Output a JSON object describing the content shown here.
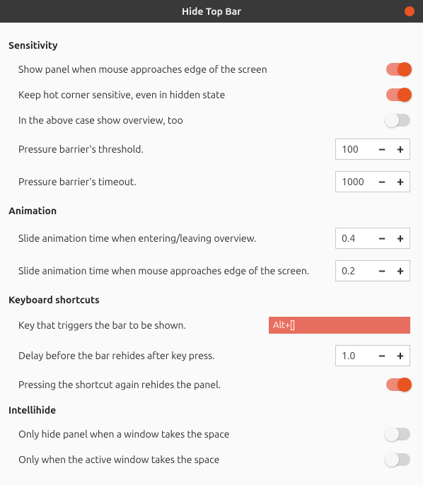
{
  "window": {
    "title": "Hide Top Bar"
  },
  "sections": {
    "sensitivity": {
      "title": "Sensitivity",
      "show_panel_mouse_edge": {
        "label": "Show panel when mouse approaches edge of the screen",
        "value": true
      },
      "hot_corner_sensitive": {
        "label": "Keep hot corner sensitive, even in hidden state",
        "value": true
      },
      "show_overview_too": {
        "label": "In the above case show overview, too",
        "value": false
      },
      "pressure_threshold": {
        "label": "Pressure barrier's threshold.",
        "value": "100"
      },
      "pressure_timeout": {
        "label": "Pressure barrier's timeout.",
        "value": "1000"
      }
    },
    "animation": {
      "title": "Animation",
      "slide_time_overview": {
        "label": "Slide animation time when entering/leaving overview.",
        "value": "0.4"
      },
      "slide_time_mouse": {
        "label": "Slide animation time when mouse approaches edge of the screen.",
        "value": "0.2"
      }
    },
    "keyboard": {
      "title": "Keyboard shortcuts",
      "trigger_key": {
        "label": "Key that triggers the bar to be shown.",
        "value": "Alt+"
      },
      "rehide_delay": {
        "label": "Delay before the bar rehides after key press.",
        "value": "1.0"
      },
      "toggle_rehide": {
        "label": "Pressing the shortcut again rehides the panel.",
        "value": true
      }
    },
    "intellihide": {
      "title": "Intellihide",
      "only_when_window": {
        "label": "Only hide panel when a window takes the space",
        "value": false
      },
      "only_active_window": {
        "label": "Only when the active window takes the space",
        "value": false
      }
    }
  }
}
